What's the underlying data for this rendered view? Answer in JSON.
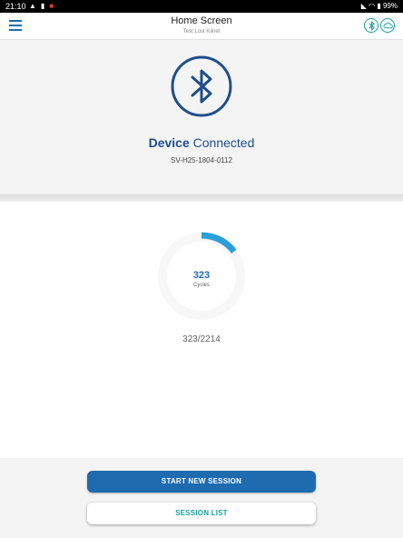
{
  "status_bar": {
    "time": "21:10",
    "icons": [
      "warning-icon",
      "notification-icon",
      "app-badge-icon"
    ],
    "battery": "99%"
  },
  "header": {
    "title": "Home Screen",
    "subtitle": "Test Lost Kilnet",
    "icons": [
      "bluetooth-icon",
      "cloud-icon"
    ]
  },
  "device": {
    "status_bold": "Device",
    "status_rest": "Connected",
    "serial": "SV-H25-1804-0112"
  },
  "cycles": {
    "value": "323",
    "unit": "Cycles",
    "summary": "323/2214",
    "progress_fraction": 0.146
  },
  "actions": {
    "start_label": "START NEW SESSION",
    "list_label": "SESSION LIST"
  },
  "colors": {
    "primary": "#1e6bb0",
    "teal": "#1aa0a0",
    "progress": "#2a9fd8",
    "track": "#e8e8e8"
  }
}
